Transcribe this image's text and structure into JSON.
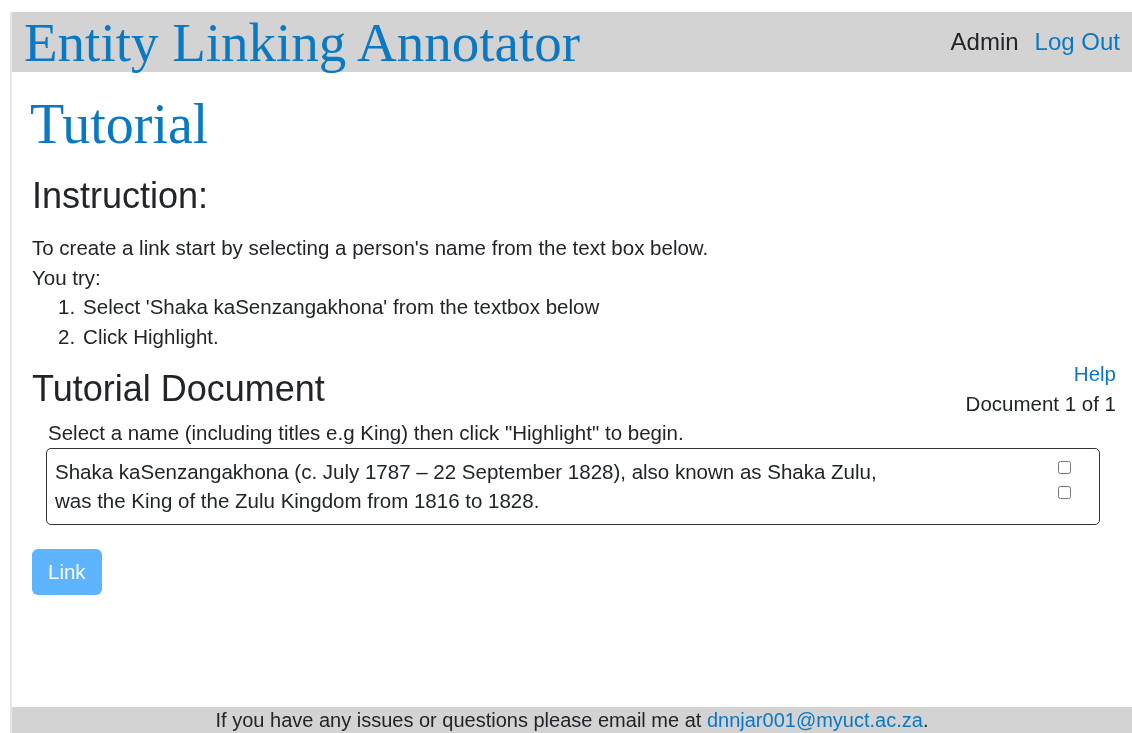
{
  "header": {
    "title": "Entity Linking Annotator",
    "user": "Admin",
    "logout": "Log Out"
  },
  "page_title": "Tutorial",
  "instruction": {
    "heading": "Instruction:",
    "lines": [
      "To create a link start by selecting a person's name from the text box below.",
      "You try:"
    ],
    "steps": [
      {
        "marker": "1.",
        "text": "Select 'Shaka kaSenzangakhona' from the textbox below"
      },
      {
        "marker": "2.",
        "text": "Click Highlight."
      }
    ]
  },
  "document": {
    "heading": "Tutorial Document",
    "help": "Help",
    "counter": "Document 1 of 1",
    "prompt": "Select a name (including titles e.g King) then click \"Highlight\" to begin.",
    "text_lines": [
      "Shaka kaSenzangakhona (c. July 1787 – 22 September 1828), also known as Shaka Zulu,",
      "was the King of the Zulu Kingdom from 1816 to 1828."
    ],
    "checkboxes": [
      {
        "checked": false
      },
      {
        "checked": false
      }
    ]
  },
  "link_button": {
    "label": "Link",
    "disabled": true
  },
  "footer": {
    "text": "If you have any issues or questions please email me at ",
    "email": "dnnjar001@myuct.ac.za",
    "end": "."
  }
}
